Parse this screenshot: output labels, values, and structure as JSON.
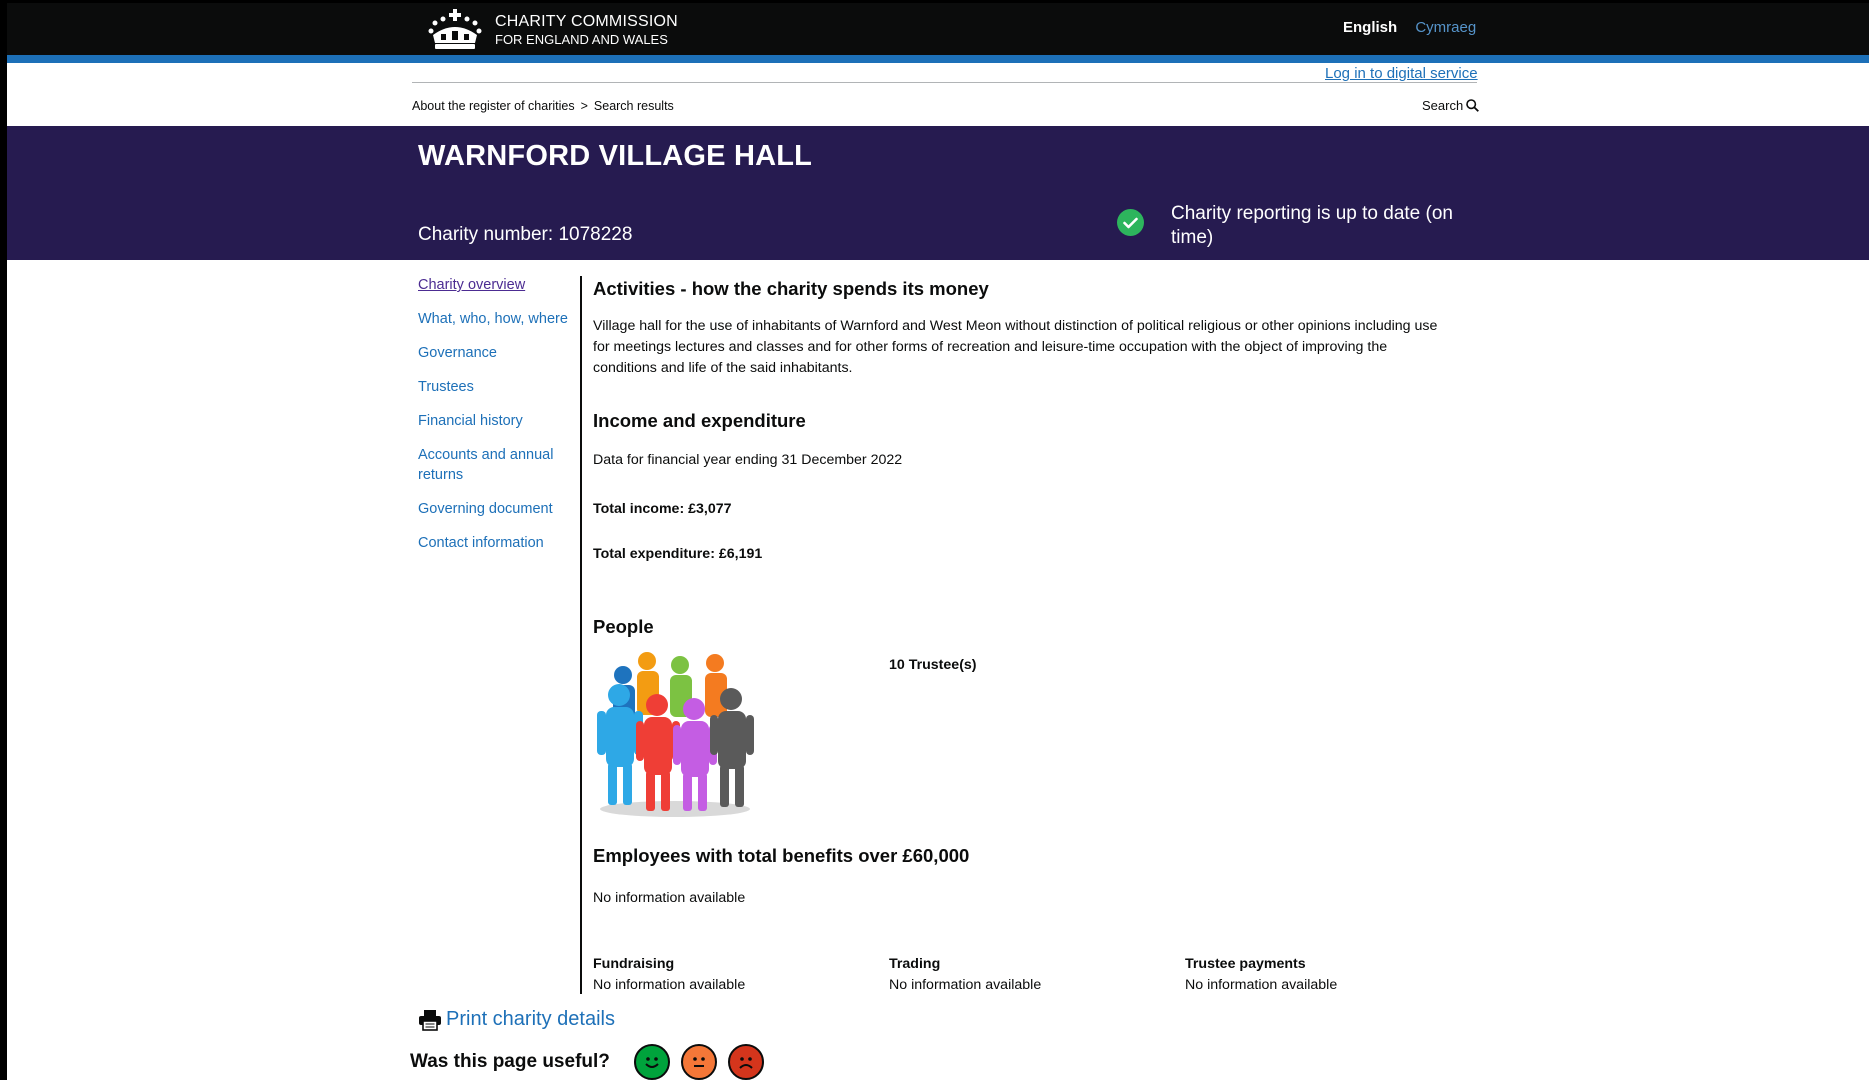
{
  "header": {
    "logo_line1": "CHARITY COMMISSION",
    "logo_line2": "FOR ENGLAND AND WALES",
    "lang_english": "English",
    "lang_welsh": "Cymraeg",
    "login_link": "Log in to digital service",
    "search_label": "Search"
  },
  "breadcrumb": {
    "items": [
      "About the register of charities",
      "Search results"
    ],
    "separator": ">"
  },
  "banner": {
    "charity_name": "WARNFORD VILLAGE HALL",
    "charity_number": "Charity number: 1078228",
    "status_text": "Charity reporting is up to date (on time)",
    "status_color": "#2db55d",
    "background": "#261b50"
  },
  "sidebar": {
    "items": [
      {
        "label": "Charity overview",
        "current": true
      },
      {
        "label": "What, who, how, where"
      },
      {
        "label": "Governance"
      },
      {
        "label": "Trustees"
      },
      {
        "label": "Financial history"
      },
      {
        "label": "Accounts and annual returns"
      },
      {
        "label": "Governing document"
      },
      {
        "label": "Contact information"
      }
    ]
  },
  "main": {
    "activities_heading": "Activities - how the charity spends its money",
    "activities_text": "Village hall for the use of inhabitants of Warnford and West Meon without distinction of political religious or other opinions including use for meetings lectures and classes and for other forms of recreation and leisure-time occupation with the object of improving the conditions and life of the said inhabitants.",
    "income_heading": "Income and expenditure",
    "financial_year": "Data for financial year ending 31 December 2022",
    "total_income": "Total income: £3,077",
    "total_expenditure": "Total expenditure: £6,191",
    "people_heading": "People",
    "trustees_count": "10 Trustee(s)",
    "employees_heading": "Employees with total benefits over £60,000",
    "employees_text": "No information available",
    "fundraising_title": "Fundraising",
    "fundraising_value": "No information available",
    "trading_title": "Trading",
    "trading_value": "No information available",
    "trustee_payments_title": "Trustee payments",
    "trustee_payments_value": "No information available"
  },
  "footer": {
    "print_label": "Print charity details",
    "useful_question": "Was this page useful?",
    "feedback_icons": [
      "happy-face-icon",
      "neutral-face-icon",
      "sad-face-icon"
    ],
    "feedback_colors": [
      "#00a33c",
      "#f47738",
      "#d4351c"
    ]
  }
}
